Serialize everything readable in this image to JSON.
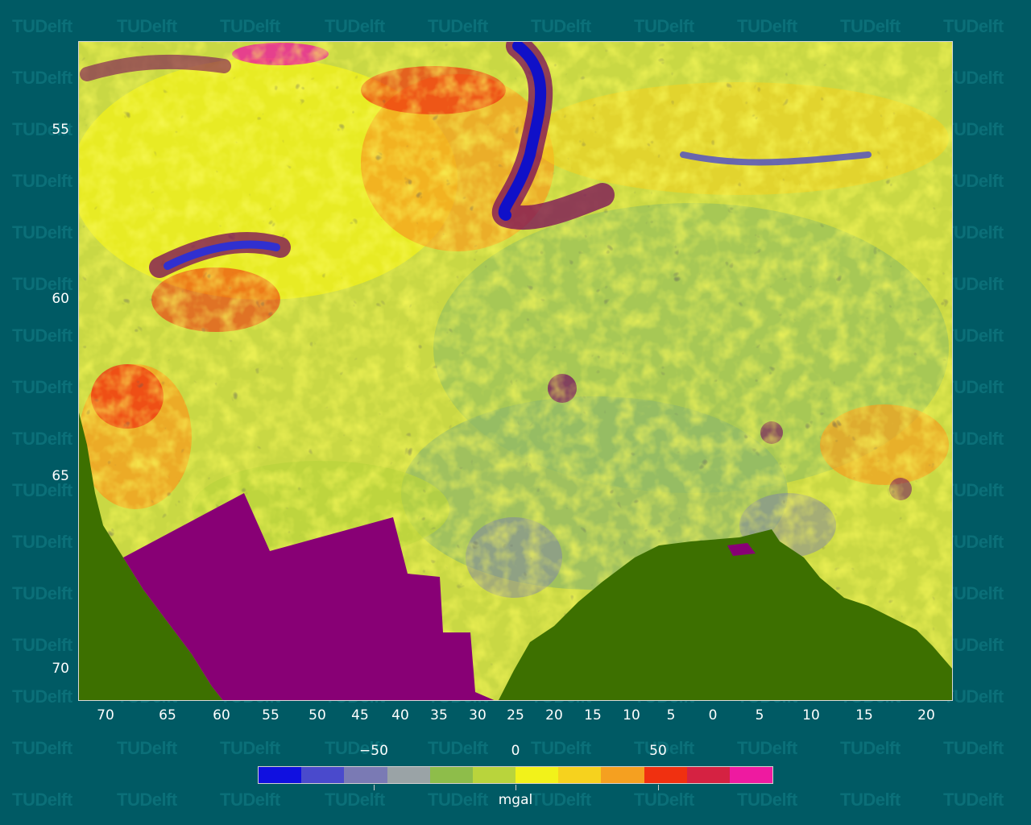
{
  "watermark": {
    "text": "TUDelft"
  },
  "map": {
    "y_labels": [
      "55",
      "60",
      "65",
      "70"
    ],
    "x_labels": [
      "70",
      "65",
      "60",
      "55",
      "50",
      "45",
      "40",
      "35",
      "30",
      "25",
      "20",
      "15",
      "10",
      "5",
      "0",
      "5",
      "10",
      "15",
      "20"
    ],
    "colors": {
      "land": "#3d7000",
      "no_data": "#880075",
      "ocean_base": "#c9d844"
    }
  },
  "colorbar": {
    "ticks": [
      "−50",
      "0",
      "50"
    ],
    "unit": "mgal",
    "colors": [
      "#1010e0",
      "#4a4acc",
      "#7a7ab4",
      "#9aa3a6",
      "#8ebd4a",
      "#b9d43c",
      "#f2f21a",
      "#f6d21e",
      "#f5a020",
      "#f03010",
      "#d52242",
      "#ee1aa0"
    ]
  }
}
